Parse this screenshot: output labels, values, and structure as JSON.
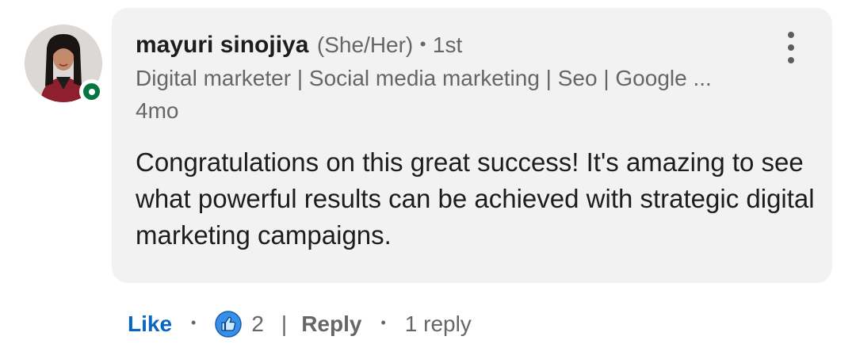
{
  "comment": {
    "author": {
      "name": "mayuri sinojiya",
      "pronouns": "(She/Her)",
      "separator": "•",
      "degree": "1st",
      "headline": "Digital marketer | Social media marketing | Seo | Google ...",
      "online": true
    },
    "timestamp": "4mo",
    "body": "Congratulations on this great success! It's amazing to see what powerful results can be achieved with strategic digital marketing campaigns."
  },
  "actions": {
    "like_label": "Like",
    "dot": "•",
    "reaction_icon": "like-reaction-icon",
    "reaction_count": "2",
    "divider": "|",
    "reply_label": "Reply",
    "reply_count": "1 reply"
  },
  "colors": {
    "like_blue": "#0a66c2",
    "online_green": "#057642",
    "bubble_bg": "#f2f2f2",
    "muted_text": "#666666"
  }
}
